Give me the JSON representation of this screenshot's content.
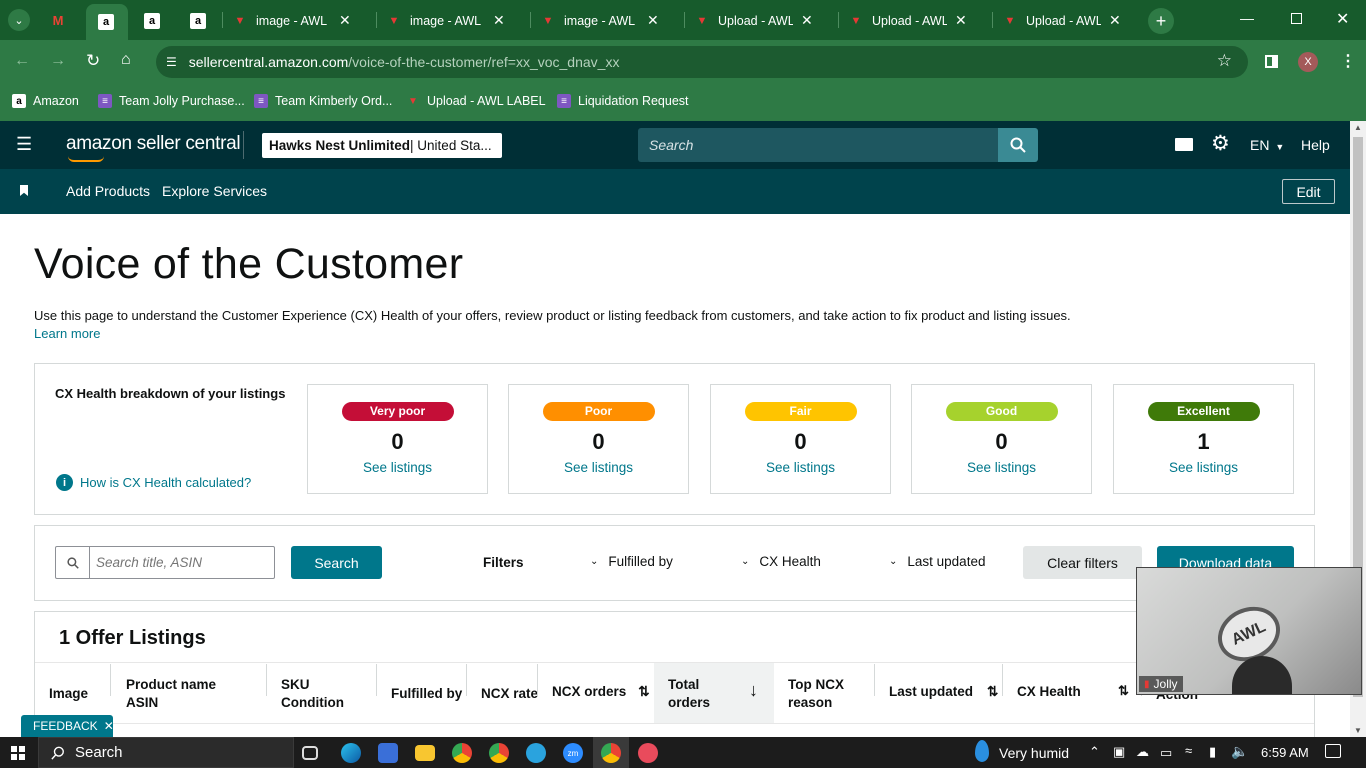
{
  "browser": {
    "tabs": [
      {
        "title": "",
        "icon": "gmail-icon"
      },
      {
        "title": "",
        "icon": "amazon-icon",
        "active": true
      },
      {
        "title": "",
        "icon": "amazon-icon"
      },
      {
        "title": "",
        "icon": "amazon-icon"
      },
      {
        "title": "image - AWL LA",
        "icon": "awl-icon"
      },
      {
        "title": "image - AWL LA",
        "icon": "awl-icon"
      },
      {
        "title": "image - AWL LA",
        "icon": "awl-icon"
      },
      {
        "title": "Upload - AWL L",
        "icon": "awl-icon"
      },
      {
        "title": "Upload - AWL L",
        "icon": "awl-icon"
      },
      {
        "title": "Upload - AWL L",
        "icon": "awl-icon"
      }
    ],
    "url_host": "sellercentral.amazon.com",
    "url_path": "/voice-of-the-customer/ref=xx_voc_dnav_xx",
    "profile_initial": "X",
    "bookmarks": [
      "Amazon",
      "Team Jolly Purchase...",
      "Team Kimberly Ord...",
      "Upload - AWL LABEL",
      "Liquidation Request"
    ]
  },
  "header": {
    "logo": "amazon seller central",
    "account_bold": "Hawks Nest Unlimited",
    "account_rest": " | United Sta...",
    "search_placeholder": "Search",
    "language": "EN",
    "help": "Help"
  },
  "subnav": {
    "items": [
      "Add Products",
      "Explore Services"
    ],
    "edit": "Edit"
  },
  "page": {
    "title": "Voice of the Customer",
    "description": "Use this page to understand the Customer Experience (CX) Health of your offers, review product or listing feedback from customers, and take action to fix product and listing issues.",
    "learn_more": "Learn more",
    "breakdown_title": "CX Health breakdown of your listings",
    "how_calc": "How is CX Health calculated?",
    "cards": [
      {
        "label": "Very poor",
        "count": "0",
        "link": "See listings",
        "color": "#c40e37",
        "text_color": "#ffffff"
      },
      {
        "label": "Poor",
        "count": "0",
        "link": "See listings",
        "color": "#ff8f00",
        "text_color": "#ffffff"
      },
      {
        "label": "Fair",
        "count": "0",
        "link": "See listings",
        "color": "#ffc400",
        "text_color": "#ffffff"
      },
      {
        "label": "Good",
        "count": "0",
        "link": "See listings",
        "color": "#a6d22d",
        "text_color": "#ffffff"
      },
      {
        "label": "Excellent",
        "count": "1",
        "link": "See listings",
        "color": "#3f7a09",
        "text_color": "#ffffff"
      }
    ],
    "search_placeholder": "Search title, ASIN",
    "search_button": "Search",
    "filters_label": "Filters",
    "filter_fulfilled": "Fulfilled by",
    "filter_cx": "CX Health",
    "filter_updated": "Last updated",
    "clear_filters": "Clear filters",
    "download": "Download data",
    "listings_title": "1 Offer Listings",
    "columns": {
      "image": "Image",
      "product_name": "Product name",
      "asin": "ASIN",
      "sku": "SKU",
      "condition": "Condition",
      "fulfilled_by": "Fulfilled by",
      "ncx_rate": "NCX rate",
      "ncx_orders": "NCX orders",
      "total": "Total",
      "orders": "orders",
      "top_ncx": "Top NCX",
      "reason": "reason",
      "last_updated": "Last updated",
      "cx_health": "CX Health",
      "action": "Action"
    },
    "feedback": "FEEDBACK"
  },
  "video": {
    "name": "Jolly"
  },
  "taskbar": {
    "search": "Search",
    "weather": "Very humid",
    "time": "6:59 AM"
  }
}
